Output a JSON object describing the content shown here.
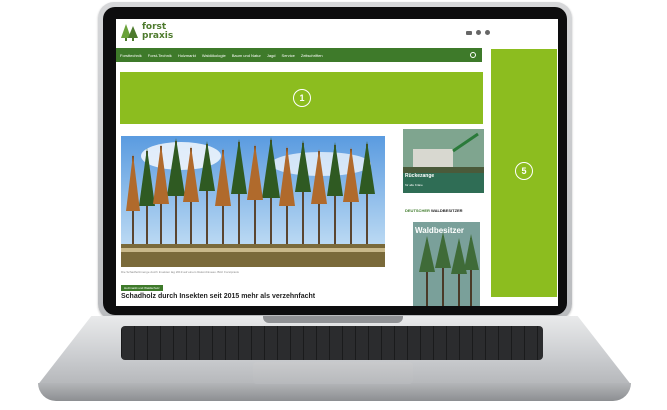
{
  "site": {
    "logo_line1": "forst",
    "logo_line2": "praxis"
  },
  "nav": {
    "items": [
      "Forsttechnik",
      "Forst-Technik",
      "Holzmarkt",
      "Waldökologie",
      "Baum und Natur",
      "Jagd",
      "Service",
      "Zeitschriften"
    ]
  },
  "banner": {
    "badge": "1"
  },
  "sidebar_ad": {
    "badge": "5"
  },
  "article": {
    "caption": "Die Schadholzmenge durch Insekten lag 2019 auf einem Rekordniveau. Bild: Forstpraxis",
    "tag": "Holzmarkt und Waldschutz",
    "headline": "Schadholz durch Insekten seit 2015 mehr als verzehnfacht"
  },
  "ad2": {
    "title": "Rückezange",
    "subtitle": "für alle Kräne"
  },
  "waldbesitzer": {
    "label_part1": "DEUTSCHER",
    "label_part2": "WALDBESITZER",
    "mag_title": "Waldbesitzer"
  },
  "colors": {
    "brand_green": "#3e7a2a",
    "ad_green": "#8cbd1f"
  }
}
